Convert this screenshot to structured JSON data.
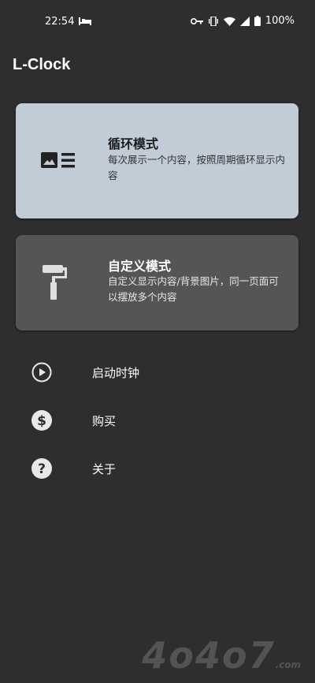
{
  "status_bar": {
    "time": "22:54",
    "battery": "100%",
    "icons": [
      "bed-icon",
      "key-icon",
      "vibrate-icon",
      "wifi-icon",
      "signal-icon",
      "battery-icon"
    ]
  },
  "app": {
    "title": "L-Clock"
  },
  "cards": [
    {
      "title": "循环模式",
      "description": "每次展示一个内容，按照周期循环显示内容",
      "icon": "image-list-icon",
      "background": "#c1ccd6"
    },
    {
      "title": "自定义模式",
      "description": "自定义显示内容/背景图片，同一页面可以摆放多个内容",
      "icon": "paint-roller-icon",
      "background": "#555555"
    }
  ],
  "menu": [
    {
      "label": "启动时钟",
      "icon": "play-circle-icon"
    },
    {
      "label": "购买",
      "icon": "dollar-circle-icon"
    },
    {
      "label": "关于",
      "icon": "help-circle-icon"
    }
  ],
  "watermark": {
    "text": "4o4o7",
    "suffix": ".com"
  }
}
